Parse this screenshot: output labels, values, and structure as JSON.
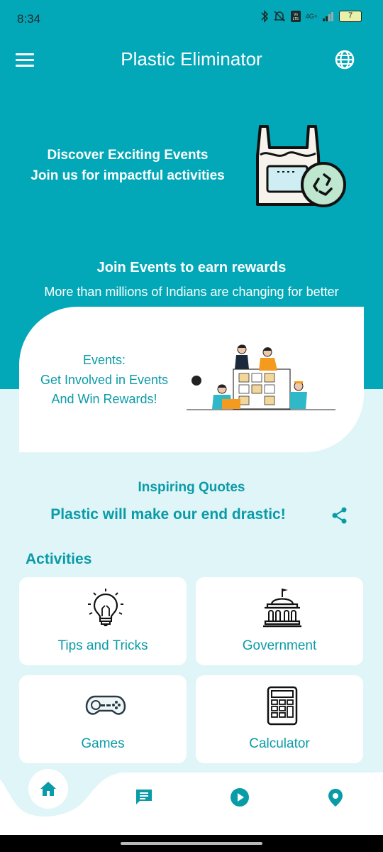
{
  "status_bar": {
    "time": "8:34",
    "network": "4G+",
    "battery": "7"
  },
  "app_bar": {
    "title": "Plastic Eliminator"
  },
  "hero": {
    "line1": "Discover Exciting Events",
    "line2": "Join us for impactful activities"
  },
  "join": {
    "title": "Join Events to earn rewards",
    "subtitle": "More than millions of Indians are changing for better"
  },
  "events_card": {
    "line1": "Events:",
    "line2": "Get Involved in Events",
    "line3": "And Win Rewards!"
  },
  "quotes": {
    "title": "Inspiring Quotes",
    "text": "Plastic will make our end drastic!"
  },
  "activities": {
    "title": "Activities",
    "items": [
      {
        "label": "Tips and Tricks",
        "icon": "lightbulb-icon"
      },
      {
        "label": "Government",
        "icon": "government-building-icon"
      },
      {
        "label": "Games",
        "icon": "gamepad-icon"
      },
      {
        "label": "Calculator",
        "icon": "calculator-icon"
      }
    ]
  },
  "bottom_nav": {
    "items": [
      "home-icon",
      "chat-icon",
      "play-icon",
      "location-pin-icon"
    ]
  },
  "colors": {
    "primary": "#03a8b8",
    "accent_text": "#0a9ba8",
    "background": "#dff5f7",
    "card": "#ffffff"
  }
}
